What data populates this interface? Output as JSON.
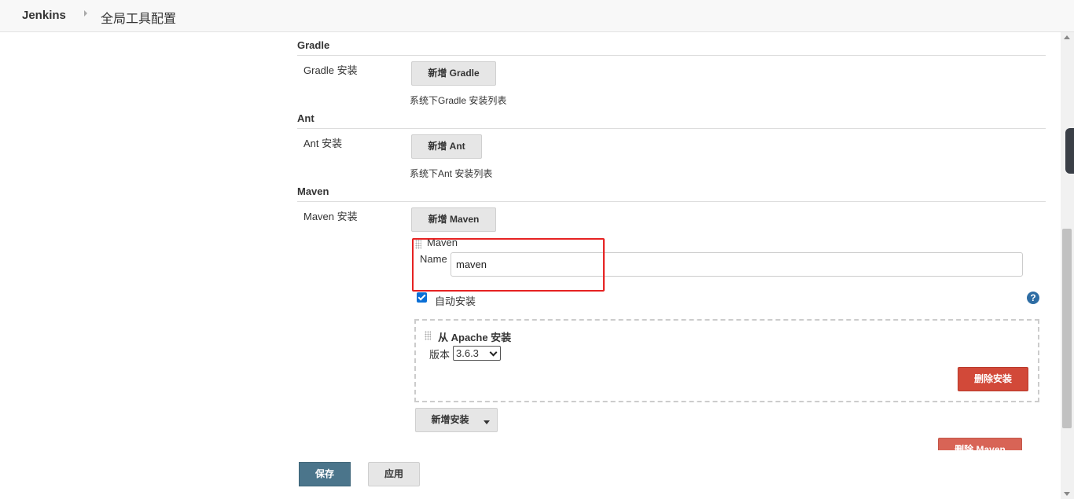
{
  "header": {
    "brand": "Jenkins",
    "breadcrumb": "全局工具配置"
  },
  "gradle": {
    "title": "Gradle",
    "label": "Gradle 安装",
    "add_button": "新增 Gradle",
    "desc": "系统下Gradle 安装列表"
  },
  "ant": {
    "title": "Ant",
    "label": "Ant 安装",
    "add_button": "新增 Ant",
    "desc": "系统下Ant 安装列表"
  },
  "maven": {
    "title": "Maven",
    "label": "Maven 安装",
    "add_button": "新增 Maven",
    "item_header": "Maven",
    "name_label": "Name",
    "name_value": "maven",
    "auto_install_label": "自动安装",
    "auto_install_checked": true,
    "installer": {
      "title": "从 Apache 安装",
      "version_label": "版本",
      "version_value": "3.6.3",
      "delete_button": "删除安装"
    },
    "add_installer_button": "新增安装",
    "delete_maven_button": "删除 Maven"
  },
  "footer": {
    "save": "保存",
    "apply": "应用"
  },
  "colors": {
    "primary": "#4b758b",
    "danger": "#d24939",
    "highlight": "#e62222",
    "checkbox": "#0b6fd6"
  },
  "icons": {
    "help": "?"
  }
}
